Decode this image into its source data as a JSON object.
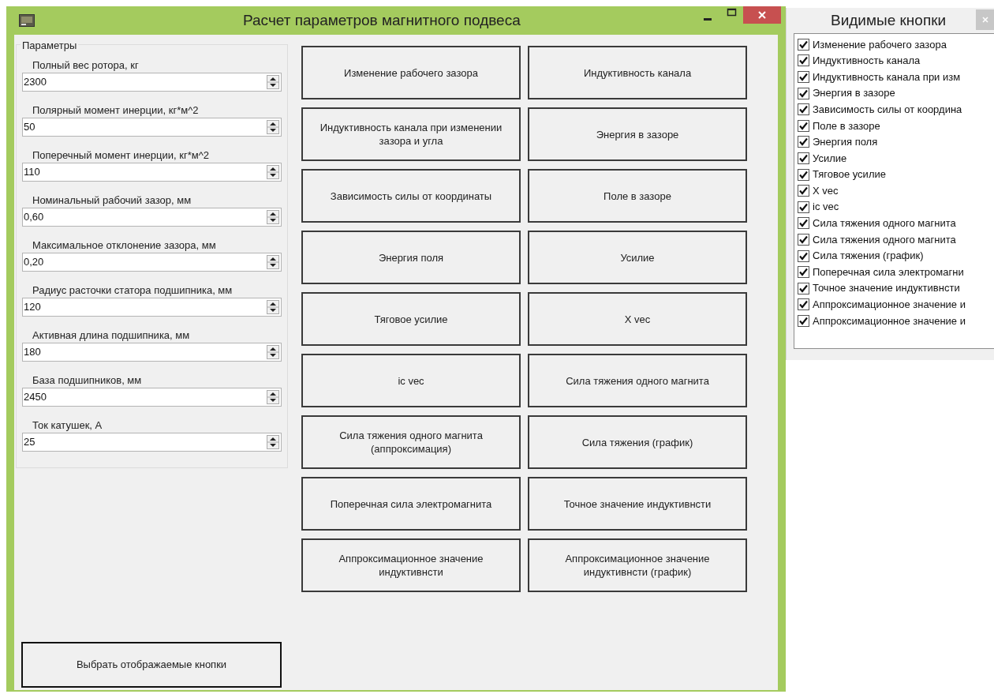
{
  "main_window": {
    "title": "Расчет параметров магнитного подвеса"
  },
  "parameters": {
    "title": "Параметры",
    "fields": [
      {
        "label": "Полный вес ротора, кг",
        "value": "2300"
      },
      {
        "label": "Полярный момент инерции, кг*м^2",
        "value": "50"
      },
      {
        "label": "Поперечный момент инерции, кг*м^2",
        "value": "110"
      },
      {
        "label": "Номинальный рабочий зазор, мм",
        "value": "0,60"
      },
      {
        "label": "Максимальное отклонение зазора, мм",
        "value": "0,20"
      },
      {
        "label": "Радиус расточки статора подшипника, мм",
        "value": "120"
      },
      {
        "label": "Активная длина подшипника, мм",
        "value": "180"
      },
      {
        "label": "База подшипников, мм",
        "value": "2450"
      },
      {
        "label": "Ток катушек, А",
        "value": "25"
      }
    ]
  },
  "buttons": [
    "Изменение рабочего зазора",
    "Индуктивность канала",
    "Индуктивность канала при изменении зазора и угла",
    "Энергия в зазоре",
    "Зависимость силы от координаты",
    "Поле в зазоре",
    "Энергия поля",
    "Усилие",
    "Тяговое усилие",
    "X vec",
    "ic vec",
    "Сила тяжения одного магнита",
    "Сила тяжения одного магнита (аппроксимация)",
    "Сила тяжения (график)",
    "Поперечная сила электромагнита",
    "Точное значение индуктивнсти",
    "Аппроксимационное значение индуктивнсти",
    "Аппроксимационное значение индуктивнсти (график)"
  ],
  "choose_button": "Выбрать отображаемые кнопки",
  "visible_buttons_window": {
    "title": "Видимые кнопки",
    "items": [
      {
        "label": "Изменение рабочего зазора",
        "checked": true
      },
      {
        "label": "Индуктивность канала",
        "checked": true
      },
      {
        "label": "Индуктивность канала при изм",
        "checked": true
      },
      {
        "label": "Энергия в зазоре",
        "checked": true
      },
      {
        "label": "Зависимость силы от координа",
        "checked": true
      },
      {
        "label": "Поле в зазоре",
        "checked": true
      },
      {
        "label": "Энергия поля",
        "checked": true
      },
      {
        "label": "Усилие",
        "checked": true
      },
      {
        "label": "Тяговое усилие",
        "checked": true
      },
      {
        "label": "X vec",
        "checked": true
      },
      {
        "label": "ic vec",
        "checked": true
      },
      {
        "label": "Сила тяжения одного магнита",
        "checked": true
      },
      {
        "label": "Сила тяжения одного магнита",
        "checked": true
      },
      {
        "label": "Сила тяжения (график)",
        "checked": true
      },
      {
        "label": "Поперечная сила электромагни",
        "checked": true
      },
      {
        "label": "Точное значение индуктивнсти",
        "checked": true
      },
      {
        "label": "Аппроксимационное значение и",
        "checked": true
      },
      {
        "label": "Аппроксимационное значение и",
        "checked": true
      }
    ]
  }
}
